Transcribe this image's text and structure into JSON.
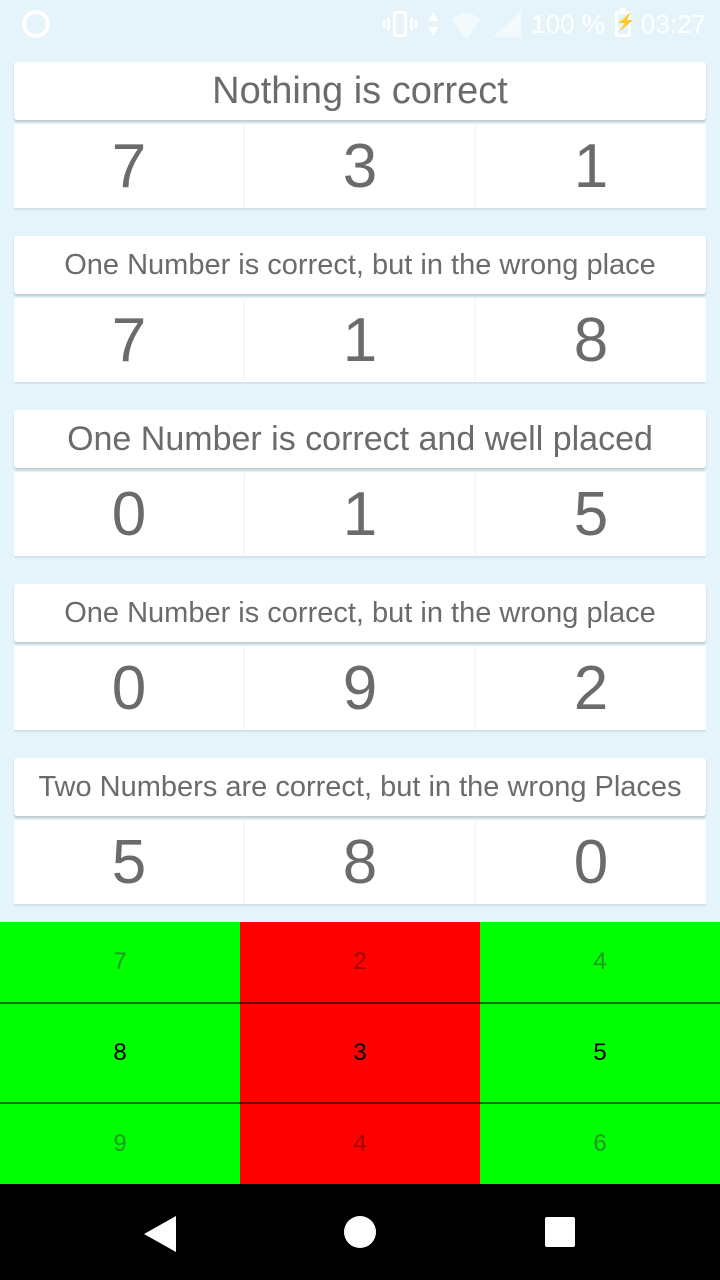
{
  "status_bar": {
    "battery_text": "100 %",
    "time": "03:27"
  },
  "clues": [
    {
      "hint": "Nothing is correct",
      "digits": [
        "7",
        "3",
        "1"
      ]
    },
    {
      "hint": "One Number is correct, but in the wrong place",
      "digits": [
        "7",
        "1",
        "8"
      ]
    },
    {
      "hint": "One Number is correct and well placed",
      "digits": [
        "0",
        "1",
        "5"
      ]
    },
    {
      "hint": "One Number is correct, but in the wrong place",
      "digits": [
        "0",
        "9",
        "2"
      ]
    },
    {
      "hint": "Two Numbers are correct, but in the wrong Places",
      "digits": [
        "5",
        "8",
        "0"
      ]
    }
  ],
  "picker": {
    "wheels": [
      {
        "above": "7",
        "selected": "8",
        "below": "9",
        "state_color": "#00ff00"
      },
      {
        "above": "2",
        "selected": "3",
        "below": "4",
        "state_color": "#ff0000"
      },
      {
        "above": "4",
        "selected": "5",
        "below": "6",
        "state_color": "#00ff00"
      }
    ]
  },
  "nav_bar": {
    "back_icon": "back-triangle-icon",
    "home_icon": "home-circle-icon",
    "recent_icon": "recents-square-icon"
  }
}
